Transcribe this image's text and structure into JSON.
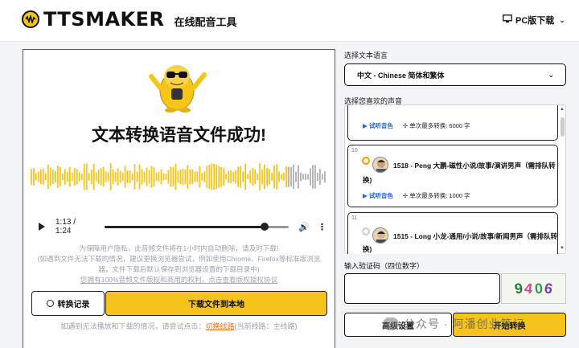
{
  "header": {
    "logo_text": "TTSMAKER",
    "logo_subtitle": "在线配音工具",
    "pc_download_label": "PC版下载",
    "monitor_icon": "monitor-icon"
  },
  "result": {
    "title": "文本转换语音文件成功!",
    "player": {
      "time": "1:13 / 1:24",
      "progress": 0.869
    },
    "notice_lines": [
      "为保障用户隐私，此音频文件将在1小时内自动删除，请及时下载!",
      "(如遇到文件无法下载的情况，建议更换浏览器尝试，例如使用Chrome、Firefox等标准版浏览",
      "器，文件下载后默认保存到浏览器设置的下载目录中)"
    ],
    "license_link": "您拥有100%音频文件版权和商用的权利，点击查看版权授权协议",
    "history_button": "转换记录",
    "download_button": "下载文件到本地",
    "help_text": "如遇到无法播放和下载的情况，请尝试点击：",
    "switch_link": "切换线路",
    "current_route": "(当前线路：主线路)"
  },
  "settings": {
    "language_label": "选择文本语言",
    "language_value": "中文 - Chinese 简体和繁体",
    "voice_label": "选择您喜欢的声音",
    "voices": [
      {
        "num": "",
        "name_line1": "",
        "name_line2": "",
        "listen": "试听音色",
        "chars": "单次最多转换: 6000 字"
      },
      {
        "num": "10",
        "name_line1": "1518 - Peng 大鹏-磁性小说/故事/演讲男声（需排队转",
        "name_line2": "换)",
        "listen": "试听音色",
        "chars": "单次最多转换: 1000 字"
      },
      {
        "num": "11",
        "name_line1": "1515 - Long 小龙-通用/小说/故事/新闻男声（需排队转",
        "name_line2": "换)",
        "listen": "",
        "chars": ""
      }
    ],
    "captcha_label": "输入验证码（四位数字）",
    "captcha_digits": [
      "9",
      "4",
      "0",
      "6"
    ],
    "advanced_button": "高级设置",
    "start_button": "开始转换"
  },
  "watermark": {
    "text": "公众号 · 阿潘创业笔记"
  },
  "colors": {
    "accent_yellow": "#f6c21c",
    "link_blue": "#2563eb",
    "link_orange": "#f97316",
    "wave_yellow": "#f5c518",
    "wave_gray": "#b0b0b0"
  }
}
